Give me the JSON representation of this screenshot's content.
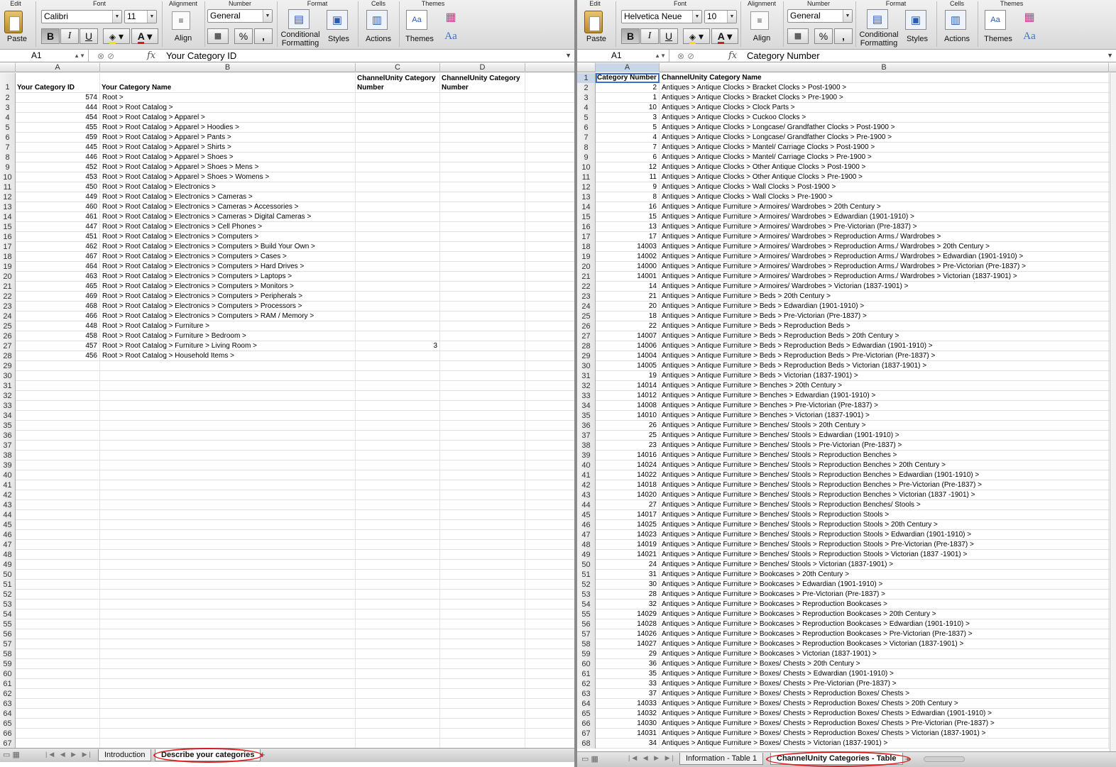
{
  "ribbon_left": {
    "groups": [
      "Edit",
      "Font",
      "Alignment",
      "Number",
      "Format",
      "Cells",
      "Themes"
    ],
    "paste": "Paste",
    "font_name": "Calibri",
    "font_size": "11",
    "bold": "B",
    "italic": "I",
    "underline": "U",
    "align": "Align",
    "number_format": "General",
    "percent": "%",
    "comma": ",",
    "cond_format_1": "Conditional",
    "cond_format_2": "Formatting",
    "styles": "Styles",
    "actions": "Actions",
    "themes": "Themes",
    "aa": "Aa"
  },
  "ribbon_right": {
    "groups": [
      "Edit",
      "Font",
      "Alignment",
      "Number",
      "Format",
      "Cells",
      "Themes"
    ],
    "paste": "Paste",
    "font_name": "Helvetica Neue",
    "font_size": "10",
    "bold": "B",
    "italic": "I",
    "underline": "U",
    "align": "Align",
    "number_format": "General",
    "percent": "%",
    "comma": ",",
    "cond_format_1": "Conditional",
    "cond_format_2": "Formatting",
    "styles": "Styles",
    "actions": "Actions",
    "themes": "Themes",
    "aa": "Aa"
  },
  "left_formula": {
    "cell_ref": "A1",
    "fx": "fx",
    "value": "Your Category ID"
  },
  "right_formula": {
    "cell_ref": "A1",
    "fx": "fx",
    "value": "Category Number"
  },
  "left_sheet": {
    "columns": [
      "A",
      "B",
      "C",
      "D"
    ],
    "headers": [
      "Your Category ID",
      "Your Category Name",
      "ChannelUnity Category Number",
      "ChannelUnity Category Number"
    ],
    "rows": [
      [
        "574",
        "Root >",
        "",
        ""
      ],
      [
        "444",
        "Root > Root Catalog >",
        "",
        ""
      ],
      [
        "454",
        "Root > Root Catalog > Apparel >",
        "",
        ""
      ],
      [
        "455",
        "Root > Root Catalog > Apparel > Hoodies >",
        "",
        ""
      ],
      [
        "459",
        "Root > Root Catalog > Apparel > Pants >",
        "",
        ""
      ],
      [
        "445",
        "Root > Root Catalog > Apparel > Shirts >",
        "",
        ""
      ],
      [
        "446",
        "Root > Root Catalog > Apparel > Shoes >",
        "",
        ""
      ],
      [
        "452",
        "Root > Root Catalog > Apparel > Shoes > Mens >",
        "",
        ""
      ],
      [
        "453",
        "Root > Root Catalog > Apparel > Shoes > Womens >",
        "",
        ""
      ],
      [
        "450",
        "Root > Root Catalog > Electronics >",
        "",
        ""
      ],
      [
        "449",
        "Root > Root Catalog > Electronics > Cameras >",
        "",
        ""
      ],
      [
        "460",
        "Root > Root Catalog > Electronics > Cameras > Accessories >",
        "",
        ""
      ],
      [
        "461",
        "Root > Root Catalog > Electronics > Cameras > Digital Cameras >",
        "",
        ""
      ],
      [
        "447",
        "Root > Root Catalog > Electronics > Cell Phones >",
        "",
        ""
      ],
      [
        "451",
        "Root > Root Catalog > Electronics > Computers >",
        "",
        ""
      ],
      [
        "462",
        "Root > Root Catalog > Electronics > Computers > Build Your Own >",
        "",
        ""
      ],
      [
        "467",
        "Root > Root Catalog > Electronics > Computers > Cases >",
        "",
        ""
      ],
      [
        "464",
        "Root > Root Catalog > Electronics > Computers > Hard Drives >",
        "",
        ""
      ],
      [
        "463",
        "Root > Root Catalog > Electronics > Computers > Laptops >",
        "",
        ""
      ],
      [
        "465",
        "Root > Root Catalog > Electronics > Computers > Monitors >",
        "",
        ""
      ],
      [
        "469",
        "Root > Root Catalog > Electronics > Computers > Peripherals >",
        "",
        ""
      ],
      [
        "468",
        "Root > Root Catalog > Electronics > Computers > Processors >",
        "",
        ""
      ],
      [
        "466",
        "Root > Root Catalog > Electronics > Computers > RAM / Memory >",
        "",
        ""
      ],
      [
        "448",
        "Root > Root Catalog > Furniture >",
        "",
        ""
      ],
      [
        "458",
        "Root > Root Catalog > Furniture > Bedroom >",
        "",
        ""
      ],
      [
        "457",
        "Root > Root Catalog > Furniture > Living Room >",
        "3",
        ""
      ],
      [
        "456",
        "Root > Root Catalog > Household Items >",
        "",
        ""
      ]
    ],
    "total_rows": 68,
    "tabs": [
      "Introduction",
      "Describe your categories"
    ],
    "active_tab": 1
  },
  "right_sheet": {
    "columns": [
      "A",
      "B"
    ],
    "headers": [
      "Category Number",
      "ChannelUnity Category Name"
    ],
    "rows": [
      [
        "2",
        "Antiques > Antique Clocks > Bracket Clocks > Post-1900 >"
      ],
      [
        "1",
        "Antiques > Antique Clocks > Bracket Clocks > Pre-1900 >"
      ],
      [
        "10",
        "Antiques > Antique Clocks > Clock Parts >"
      ],
      [
        "3",
        "Antiques > Antique Clocks > Cuckoo Clocks >"
      ],
      [
        "5",
        "Antiques > Antique Clocks > Longcase/ Grandfather Clocks > Post-1900 >"
      ],
      [
        "4",
        "Antiques > Antique Clocks > Longcase/ Grandfather Clocks > Pre-1900 >"
      ],
      [
        "7",
        "Antiques > Antique Clocks > Mantel/ Carriage Clocks > Post-1900 >"
      ],
      [
        "6",
        "Antiques > Antique Clocks > Mantel/ Carriage Clocks > Pre-1900 >"
      ],
      [
        "12",
        "Antiques > Antique Clocks > Other Antique Clocks > Post-1900 >"
      ],
      [
        "11",
        "Antiques > Antique Clocks > Other Antique Clocks > Pre-1900 >"
      ],
      [
        "9",
        "Antiques > Antique Clocks > Wall Clocks > Post-1900 >"
      ],
      [
        "8",
        "Antiques > Antique Clocks > Wall Clocks > Pre-1900 >"
      ],
      [
        "16",
        "Antiques > Antique Furniture > Armoires/ Wardrobes > 20th Century >"
      ],
      [
        "15",
        "Antiques > Antique Furniture > Armoires/ Wardrobes > Edwardian (1901-1910) >"
      ],
      [
        "13",
        "Antiques > Antique Furniture > Armoires/ Wardrobes > Pre-Victorian (Pre-1837) >"
      ],
      [
        "17",
        "Antiques > Antique Furniture > Armoires/ Wardrobes > Reproduction Arms./ Wardrobes >"
      ],
      [
        "14003",
        "Antiques > Antique Furniture > Armoires/ Wardrobes > Reproduction Arms./ Wardrobes > 20th Century >"
      ],
      [
        "14002",
        "Antiques > Antique Furniture > Armoires/ Wardrobes > Reproduction Arms./ Wardrobes > Edwardian (1901-1910) >"
      ],
      [
        "14000",
        "Antiques > Antique Furniture > Armoires/ Wardrobes > Reproduction Arms./ Wardrobes > Pre-Victorian (Pre-1837) >"
      ],
      [
        "14001",
        "Antiques > Antique Furniture > Armoires/ Wardrobes > Reproduction Arms./ Wardrobes > Victorian (1837-1901) >"
      ],
      [
        "14",
        "Antiques > Antique Furniture > Armoires/ Wardrobes > Victorian (1837-1901) >"
      ],
      [
        "21",
        "Antiques > Antique Furniture > Beds > 20th Century >"
      ],
      [
        "20",
        "Antiques > Antique Furniture > Beds > Edwardian (1901-1910) >"
      ],
      [
        "18",
        "Antiques > Antique Furniture > Beds > Pre-Victorian (Pre-1837) >"
      ],
      [
        "22",
        "Antiques > Antique Furniture > Beds > Reproduction Beds >"
      ],
      [
        "14007",
        "Antiques > Antique Furniture > Beds > Reproduction Beds > 20th Century >"
      ],
      [
        "14006",
        "Antiques > Antique Furniture > Beds > Reproduction Beds > Edwardian (1901-1910) >"
      ],
      [
        "14004",
        "Antiques > Antique Furniture > Beds > Reproduction Beds > Pre-Victorian (Pre-1837) >"
      ],
      [
        "14005",
        "Antiques > Antique Furniture > Beds > Reproduction Beds > Victorian (1837-1901) >"
      ],
      [
        "19",
        "Antiques > Antique Furniture > Beds > Victorian (1837-1901) >"
      ],
      [
        "14014",
        "Antiques > Antique Furniture > Benches > 20th Century >"
      ],
      [
        "14012",
        "Antiques > Antique Furniture > Benches > Edwardian (1901-1910) >"
      ],
      [
        "14008",
        "Antiques > Antique Furniture > Benches > Pre-Victorian (Pre-1837) >"
      ],
      [
        "14010",
        "Antiques > Antique Furniture > Benches > Victorian (1837-1901) >"
      ],
      [
        "26",
        "Antiques > Antique Furniture > Benches/ Stools > 20th Century >"
      ],
      [
        "25",
        "Antiques > Antique Furniture > Benches/ Stools > Edwardian (1901-1910) >"
      ],
      [
        "23",
        "Antiques > Antique Furniture > Benches/ Stools > Pre-Victorian (Pre-1837) >"
      ],
      [
        "14016",
        "Antiques > Antique Furniture > Benches/ Stools > Reproduction Benches >"
      ],
      [
        "14024",
        "Antiques > Antique Furniture > Benches/ Stools > Reproduction Benches > 20th Century >"
      ],
      [
        "14022",
        "Antiques > Antique Furniture > Benches/ Stools > Reproduction Benches > Edwardian (1901-1910) >"
      ],
      [
        "14018",
        "Antiques > Antique Furniture > Benches/ Stools > Reproduction Benches > Pre-Victorian (Pre-1837) >"
      ],
      [
        "14020",
        "Antiques > Antique Furniture > Benches/ Stools > Reproduction Benches > Victorian (1837 -1901) >"
      ],
      [
        "27",
        "Antiques > Antique Furniture > Benches/ Stools > Reproduction Benches/ Stools >"
      ],
      [
        "14017",
        "Antiques > Antique Furniture > Benches/ Stools > Reproduction Stools >"
      ],
      [
        "14025",
        "Antiques > Antique Furniture > Benches/ Stools > Reproduction Stools > 20th Century >"
      ],
      [
        "14023",
        "Antiques > Antique Furniture > Benches/ Stools > Reproduction Stools > Edwardian (1901-1910) >"
      ],
      [
        "14019",
        "Antiques > Antique Furniture > Benches/ Stools > Reproduction Stools > Pre-Victorian (Pre-1837) >"
      ],
      [
        "14021",
        "Antiques > Antique Furniture > Benches/ Stools > Reproduction Stools > Victorian (1837 -1901) >"
      ],
      [
        "24",
        "Antiques > Antique Furniture > Benches/ Stools > Victorian (1837-1901) >"
      ],
      [
        "31",
        "Antiques > Antique Furniture > Bookcases > 20th Century >"
      ],
      [
        "30",
        "Antiques > Antique Furniture > Bookcases > Edwardian (1901-1910) >"
      ],
      [
        "28",
        "Antiques > Antique Furniture > Bookcases > Pre-Victorian (Pre-1837) >"
      ],
      [
        "32",
        "Antiques > Antique Furniture > Bookcases > Reproduction Bookcases >"
      ],
      [
        "14029",
        "Antiques > Antique Furniture > Bookcases > Reproduction Bookcases > 20th Century >"
      ],
      [
        "14028",
        "Antiques > Antique Furniture > Bookcases > Reproduction Bookcases > Edwardian (1901-1910) >"
      ],
      [
        "14026",
        "Antiques > Antique Furniture > Bookcases > Reproduction Bookcases > Pre-Victorian (Pre-1837) >"
      ],
      [
        "14027",
        "Antiques > Antique Furniture > Bookcases > Reproduction Bookcases > Victorian (1837-1901) >"
      ],
      [
        "29",
        "Antiques > Antique Furniture > Bookcases > Victorian (1837-1901) >"
      ],
      [
        "36",
        "Antiques > Antique Furniture > Boxes/ Chests > 20th Century >"
      ],
      [
        "35",
        "Antiques > Antique Furniture > Boxes/ Chests > Edwardian (1901-1910) >"
      ],
      [
        "33",
        "Antiques > Antique Furniture > Boxes/ Chests > Pre-Victorian (Pre-1837) >"
      ],
      [
        "37",
        "Antiques > Antique Furniture > Boxes/ Chests > Reproduction Boxes/ Chests >"
      ],
      [
        "14033",
        "Antiques > Antique Furniture > Boxes/ Chests > Reproduction Boxes/ Chests > 20th Century >"
      ],
      [
        "14032",
        "Antiques > Antique Furniture > Boxes/ Chests > Reproduction Boxes/ Chests > Edwardian (1901-1910) >"
      ],
      [
        "14030",
        "Antiques > Antique Furniture > Boxes/ Chests > Reproduction Boxes/ Chests > Pre-Victorian (Pre-1837) >"
      ],
      [
        "14031",
        "Antiques > Antique Furniture > Boxes/ Chests > Reproduction Boxes/ Chests > Victorian (1837-1901) >"
      ],
      [
        "34",
        "Antiques > Antique Furniture > Boxes/ Chests > Victorian (1837-1901) >"
      ]
    ],
    "total_rows": 68,
    "tabs": [
      "Information - Table 1",
      "ChannelUnity Categories - Table"
    ],
    "active_tab": 1
  },
  "colors": {
    "highlight_ring": "#e0191b",
    "font_color_bar": "#d9181a",
    "fill_color_bar": "#f6e200"
  }
}
